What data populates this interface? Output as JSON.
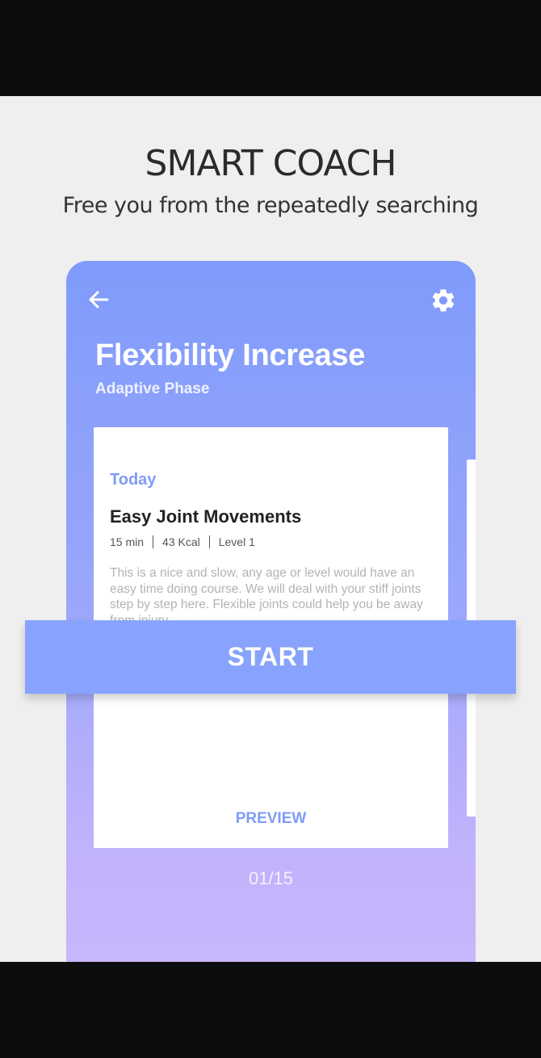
{
  "promo": {
    "title": "SMART COACH",
    "subtitle": "Free you from the repeatedly searching"
  },
  "header": {
    "back_icon": "arrow-left-icon",
    "settings_icon": "gear-icon",
    "title": "Flexibility Increase",
    "phase": "Adaptive Phase"
  },
  "card": {
    "day_label": "Today",
    "course_title": "Easy Joint Movements",
    "duration": "15 min",
    "calories": "43 Kcal",
    "level": "Level 1",
    "description": "This is a nice and slow, any age or level would have an easy time doing course. We will deal with your stiff joints step by step here. Flexible joints could help you be away from injury.",
    "start_label": "START",
    "preview_label": "PREVIEW"
  },
  "pager": {
    "text": "01/15"
  },
  "colors": {
    "accent": "#7f9bf7",
    "start_button": "#88a3fd",
    "gradient_top": "#7f9bfb",
    "gradient_bottom": "#cab7fc"
  }
}
